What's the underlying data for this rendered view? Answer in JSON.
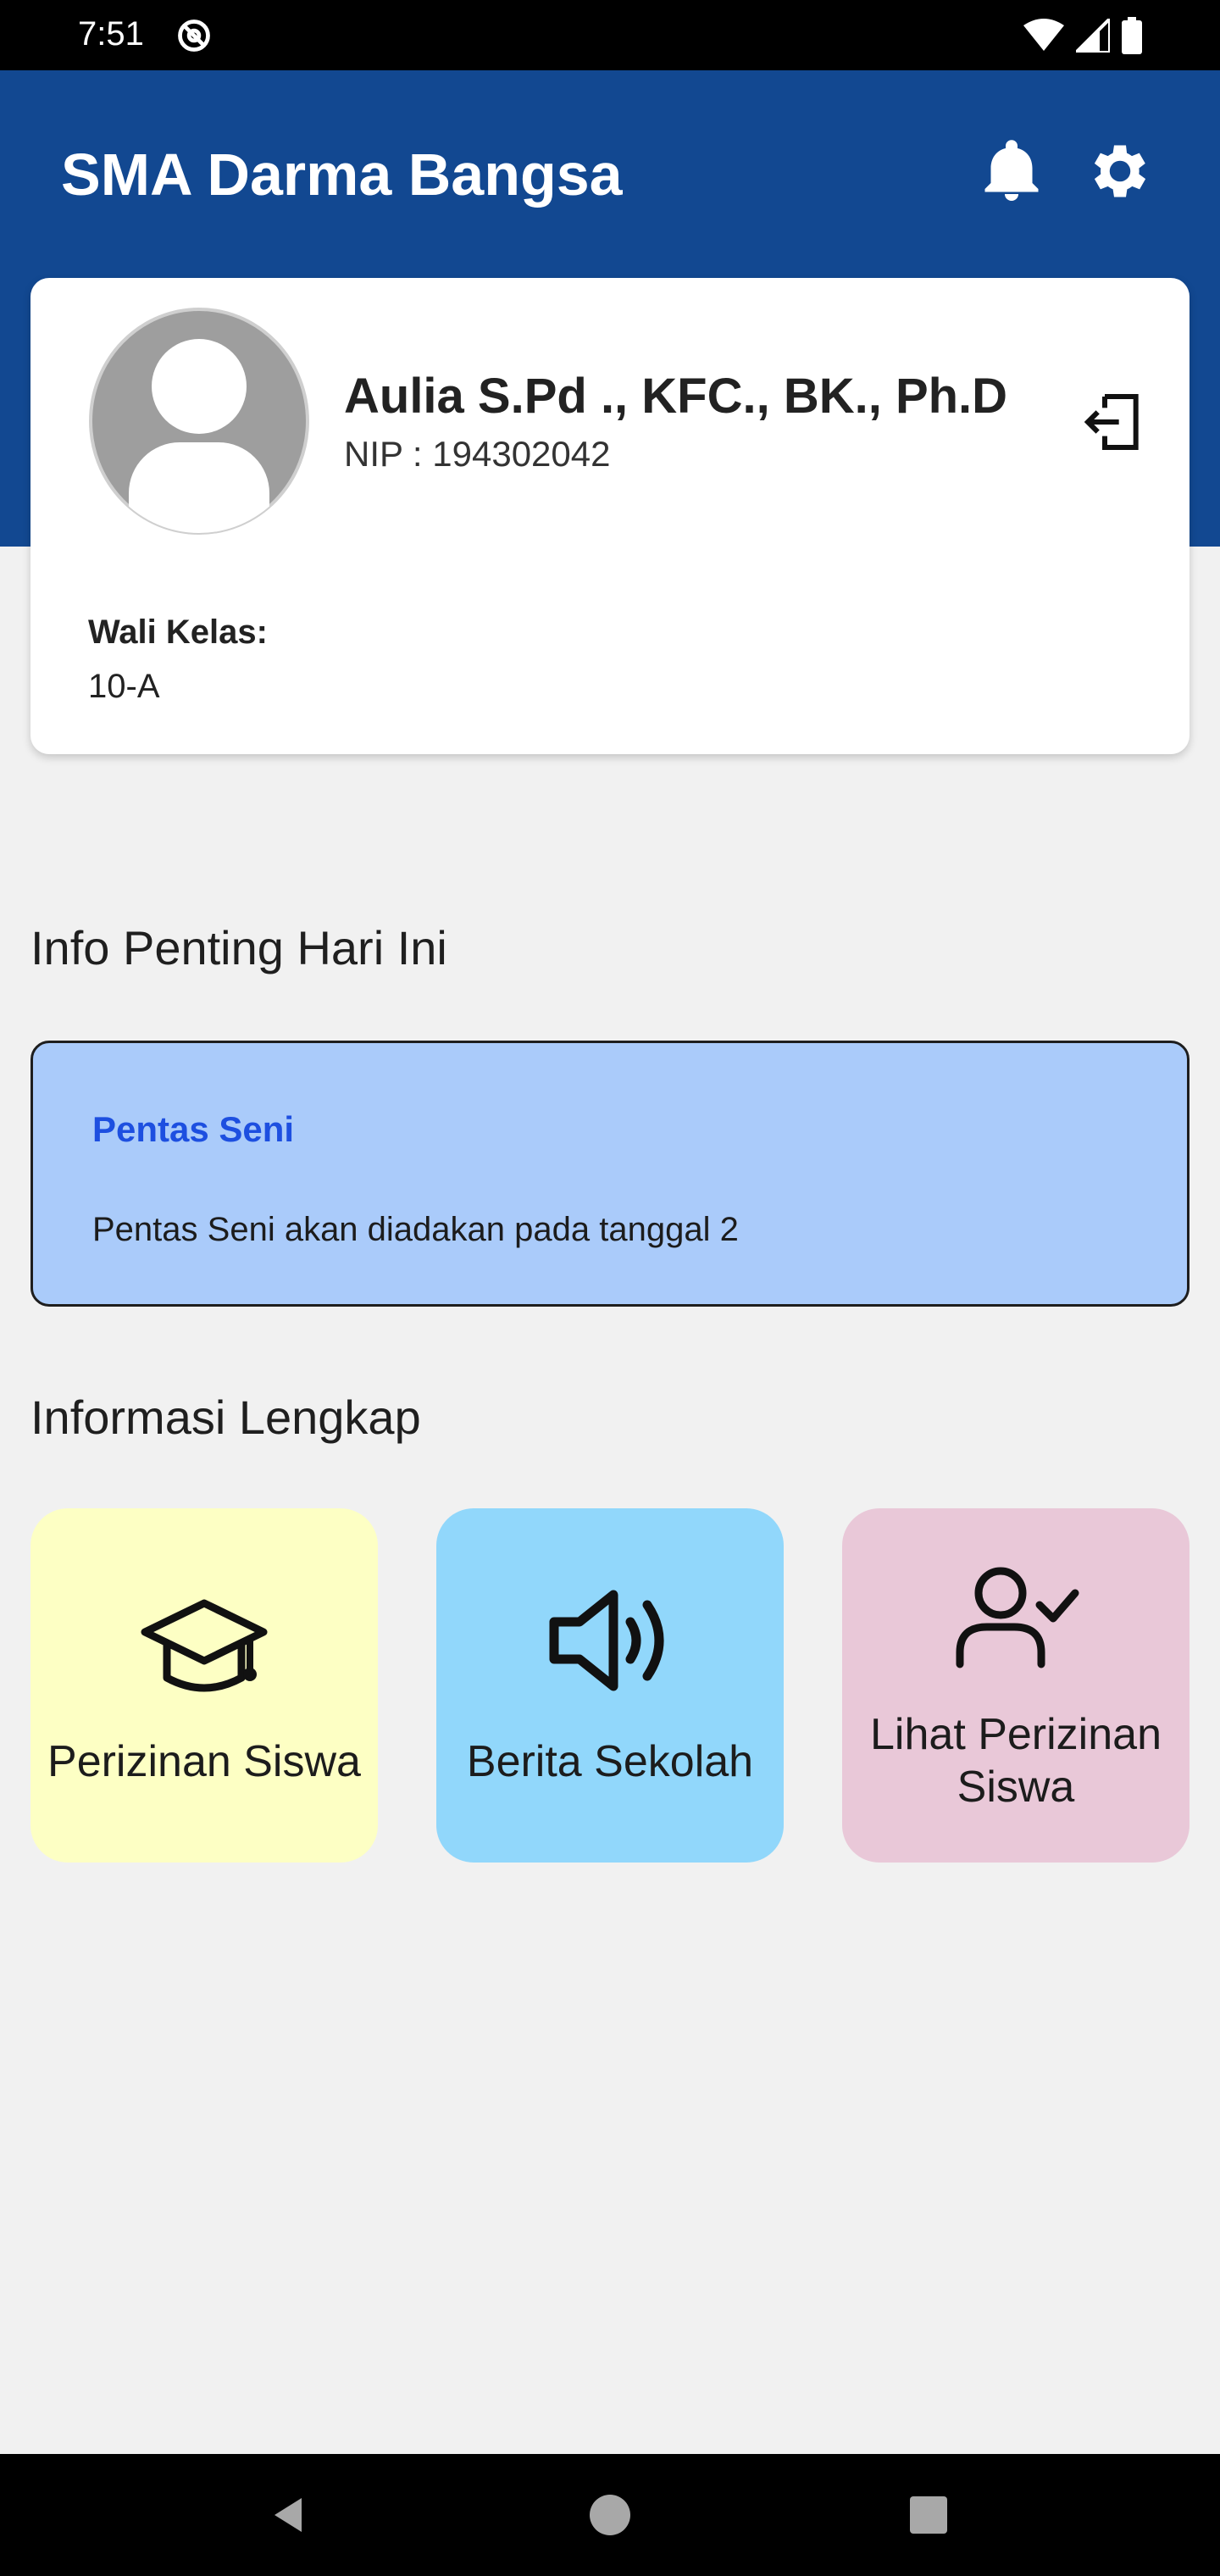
{
  "status_bar": {
    "time": "7:51",
    "icons": [
      "at-sign-icon",
      "wifi-icon",
      "signal-icon",
      "battery-icon"
    ]
  },
  "header": {
    "title": "SMA Darma Bangsa",
    "icons": [
      "bell-icon",
      "gear-icon"
    ],
    "background": "#124891"
  },
  "profile": {
    "name": "Aulia S.Pd ., KFC., BK., Ph.D",
    "nip": "NIP : 194302042",
    "wali_label": "Wali Kelas:",
    "wali_value": "10-A"
  },
  "info_penting": {
    "section_title": "Info Penting Hari Ini",
    "card_title": "Pentas Seni",
    "card_body": "Pentas Seni akan diadakan pada tanggal 2",
    "card_color": "#aacbfa"
  },
  "informasi_lengkap": {
    "section_title": "Informasi Lengkap",
    "tiles": [
      {
        "label": "Perizinan Siswa",
        "icon": "graduation-cap-icon",
        "color": "#fdffc4"
      },
      {
        "label": "Berita Sekolah",
        "icon": "speaker-icon",
        "color": "#91d7fb"
      },
      {
        "label": "Lihat Perizinan Siswa",
        "icon": "user-check-icon",
        "color": "#e9c8d8"
      }
    ]
  },
  "nav_bar": {
    "buttons": [
      "back-icon",
      "home-icon",
      "recents-icon"
    ]
  }
}
